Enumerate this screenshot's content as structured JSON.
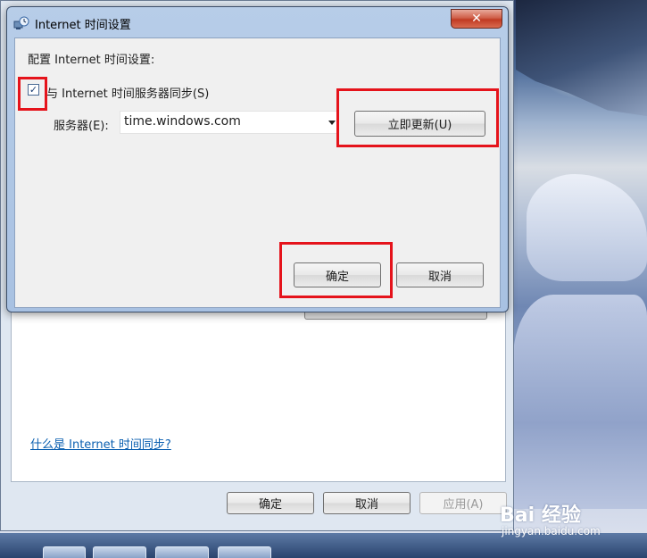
{
  "dialog": {
    "title": "Internet 时间设置",
    "close_glyph": "✕",
    "heading": "配置 Internet 时间设置:",
    "sync_checkbox": {
      "label": "与 Internet 时间服务器同步(S)",
      "checked": true,
      "mark": "✓"
    },
    "server": {
      "label": "服务器(E):",
      "value": "time.windows.com"
    },
    "update_now_label": "立即更新(U)",
    "ok_label": "确定",
    "cancel_label": "取消"
  },
  "parent_dialog": {
    "help_link": "什么是 Internet 时间同步?",
    "ok_label": "确定",
    "cancel_label": "取消",
    "apply_label": "应用(A)",
    "apply_enabled": false
  },
  "watermark": {
    "logo": "Bai 经验",
    "url": "jingyan.baidu.com"
  },
  "colors": {
    "highlight": "#e5131b",
    "link": "#0a5fb0"
  }
}
